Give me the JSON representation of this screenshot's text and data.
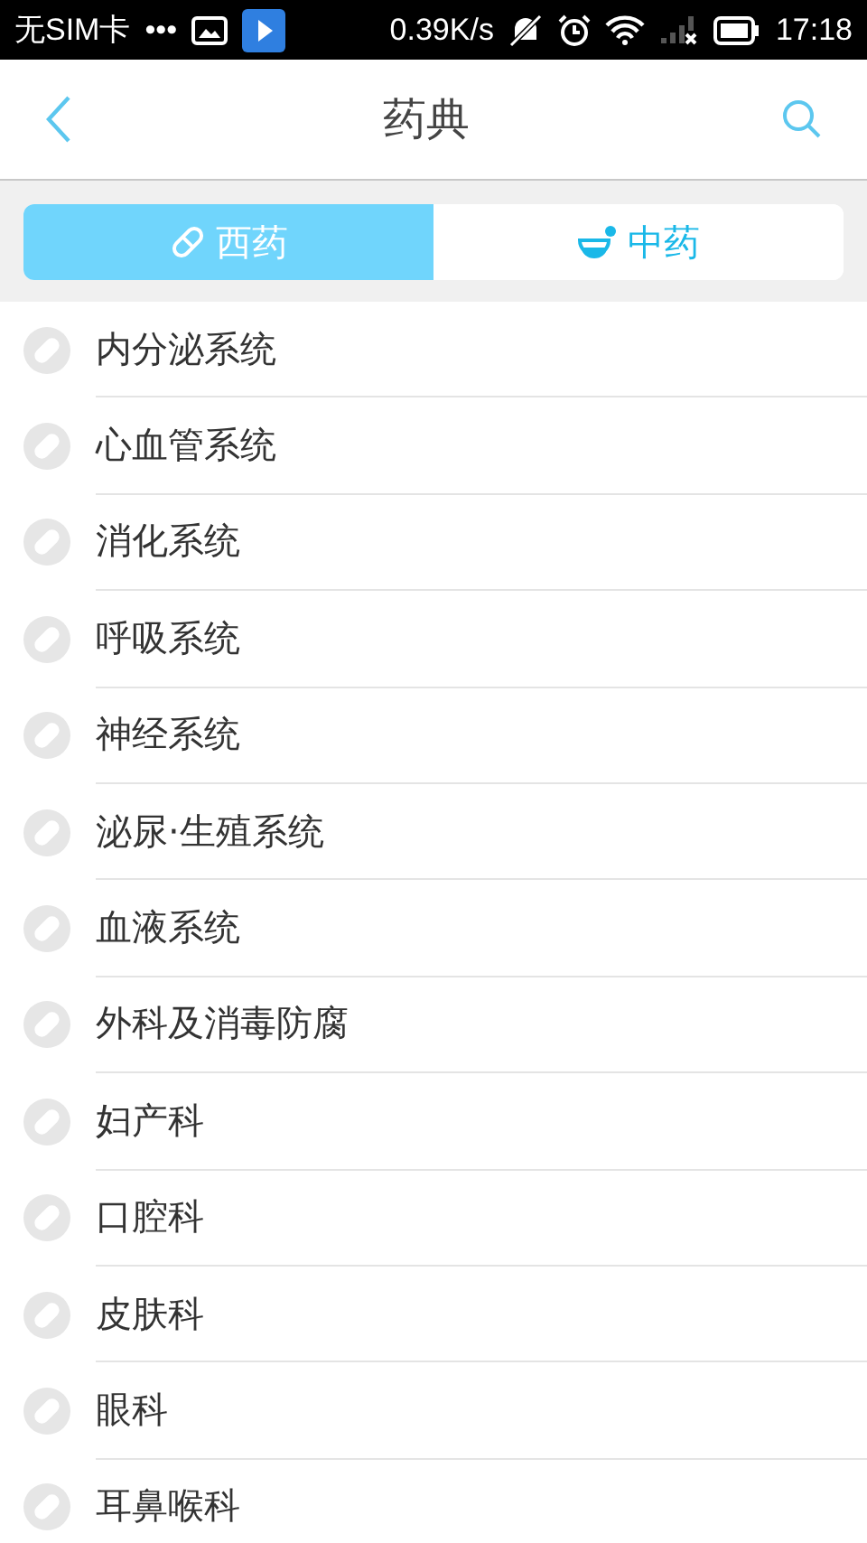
{
  "status_bar": {
    "carrier": "无SIM卡",
    "dots": "•••",
    "speed": "0.39K/s",
    "time": "17:18"
  },
  "header": {
    "title": "药典"
  },
  "tabs": [
    {
      "label": "西药",
      "kind": "pill",
      "selected": true
    },
    {
      "label": "中药",
      "kind": "bowl",
      "selected": false
    }
  ],
  "categories": [
    "内分泌系统",
    "心血管系统",
    "消化系统",
    "呼吸系统",
    "神经系统",
    "泌尿·生殖系统",
    "血液系统",
    "外科及消毒防腐",
    "妇产科",
    "口腔科",
    "皮肤科",
    "眼科",
    "耳鼻喉科"
  ]
}
